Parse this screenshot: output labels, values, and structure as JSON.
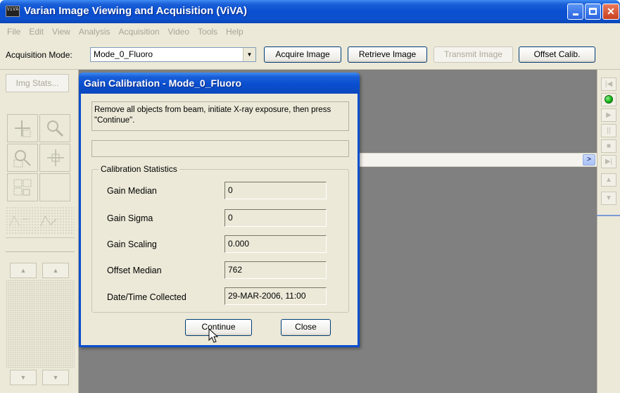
{
  "window": {
    "title": "Varian Image Viewing and Acquisition (ViVA)",
    "icon_label": "ViVA"
  },
  "menu": [
    "File",
    "Edit",
    "View",
    "Analysis",
    "Acquisition",
    "Video",
    "Tools",
    "Help"
  ],
  "toolbar": {
    "mode_label": "Acquisition Mode:",
    "mode_value": "Mode_0_Fluoro",
    "acquire": "Acquire Image",
    "retrieve": "Retrieve Image",
    "transmit": "Transmit Image",
    "offset": "Offset Calib."
  },
  "left_panel": {
    "img_stats": "Img Stats..."
  },
  "dialog": {
    "title": "Gain Calibration - Mode_0_Fluoro",
    "instruction": "Remove all objects from beam, initiate X-ray exposure, then press \"Continue\".",
    "progress": 0,
    "stats_title": "Calibration Statistics",
    "stats": [
      {
        "label": "Gain Median",
        "value": "0"
      },
      {
        "label": "Gain Sigma",
        "value": "0"
      },
      {
        "label": "Gain Scaling",
        "value": "0.000"
      },
      {
        "label": "Offset Median",
        "value": "762"
      },
      {
        "label": "Date/Time Collected",
        "value": "29-MAR-2006, 11:00"
      }
    ],
    "continue": "Continue",
    "close": "Close"
  },
  "colors": {
    "title_blue": "#0a4fd0",
    "face": "#ece9d8",
    "viewport": "#808080",
    "live_led": "#11b011"
  },
  "icons": [
    "app-icon",
    "minimize-icon",
    "maximize-icon",
    "close-icon",
    "dropdown-arrow-icon",
    "roi-select-icon",
    "zoom-icon",
    "zoom-region-icon",
    "pan-icon",
    "grid-select-icon",
    "profile-icon",
    "scroll-right-icon",
    "first-frame-icon",
    "live-led-icon",
    "play-icon",
    "pause-icon",
    "stop-icon",
    "last-frame-icon",
    "up-arrow-icon",
    "down-arrow-icon",
    "mouse-cursor-icon"
  ]
}
